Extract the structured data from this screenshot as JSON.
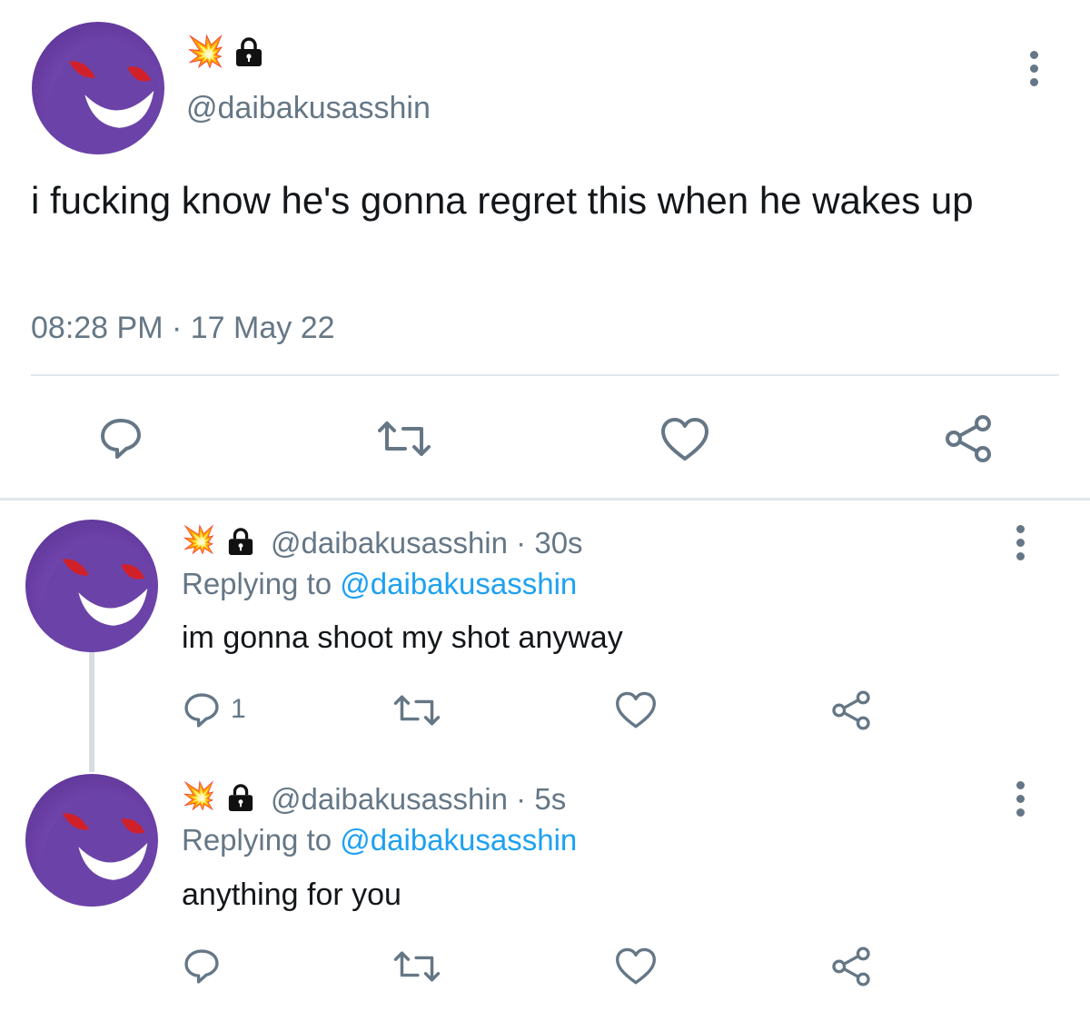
{
  "main_tweet": {
    "handle": "@daibakusasshin",
    "badge_icons": [
      "collision-emoji",
      "lock-icon"
    ],
    "text": "i fucking know he's gonna regret this when he wakes up",
    "time": "08:28 PM",
    "date": "17 May 22",
    "separator": "·"
  },
  "replies": [
    {
      "handle": "@daibakusasshin",
      "age": "30s",
      "replying_label": "Replying to",
      "replying_to": "@daibakusasshin",
      "text": "im gonna shoot my shot anyway",
      "reply_count": "1"
    },
    {
      "handle": "@daibakusasshin",
      "age": "5s",
      "replying_label": "Replying to",
      "replying_to": "@daibakusasshin",
      "text": "anything for you",
      "reply_count": ""
    }
  ],
  "colors": {
    "secondary_text": "#657786",
    "link": "#1da1f2",
    "divider": "#e1e8ed"
  }
}
